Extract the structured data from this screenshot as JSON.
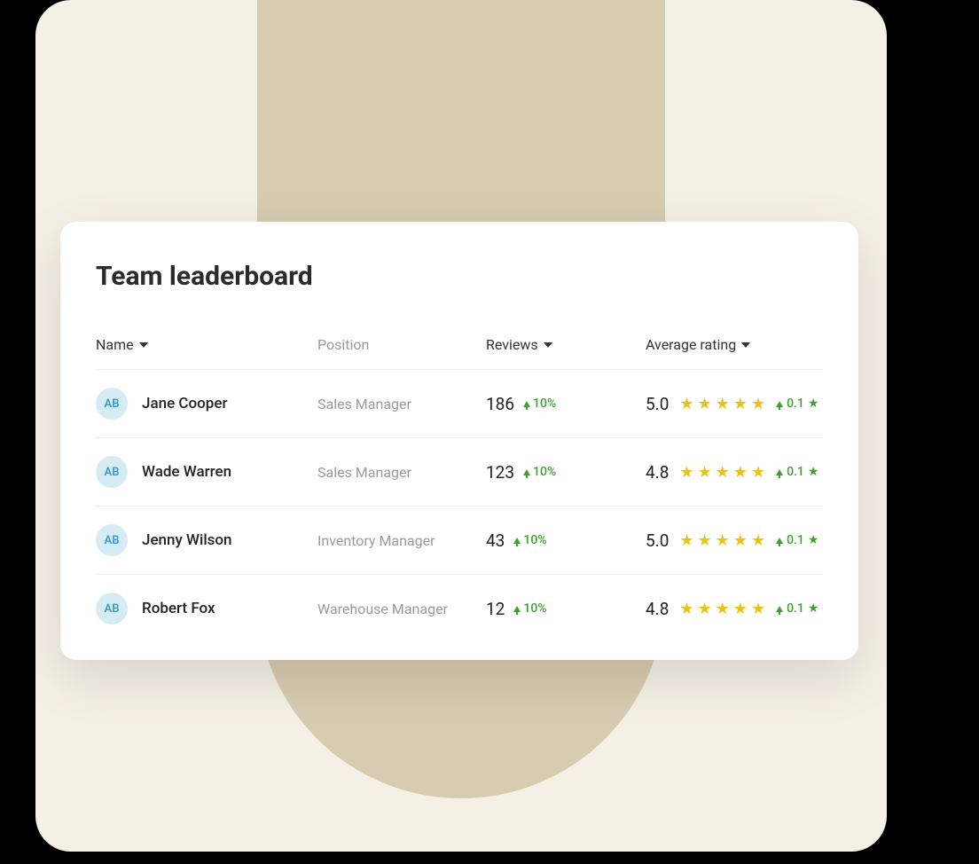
{
  "title": "Team leaderboard",
  "columns": {
    "name": "Name",
    "position": "Position",
    "reviews": "Reviews",
    "rating": "Average rating"
  },
  "avatar_initials": "AB",
  "rows": [
    {
      "name": "Jane Cooper",
      "position": "Sales Manager",
      "reviews": "186",
      "reviews_delta": "10%",
      "rating": "5.0",
      "stars": 5,
      "rating_delta": "0.1"
    },
    {
      "name": "Wade Warren",
      "position": "Sales Manager",
      "reviews": "123",
      "reviews_delta": "10%",
      "rating": "4.8",
      "stars": 5,
      "rating_delta": "0.1"
    },
    {
      "name": "Jenny Wilson",
      "position": "Inventory Manager",
      "reviews": "43",
      "reviews_delta": "10%",
      "rating": "5.0",
      "stars": 5,
      "rating_delta": "0.1"
    },
    {
      "name": "Robert Fox",
      "position": "Warehouse Manager",
      "reviews": "12",
      "reviews_delta": "10%",
      "rating": "4.8",
      "stars": 5,
      "rating_delta": "0.1"
    }
  ]
}
